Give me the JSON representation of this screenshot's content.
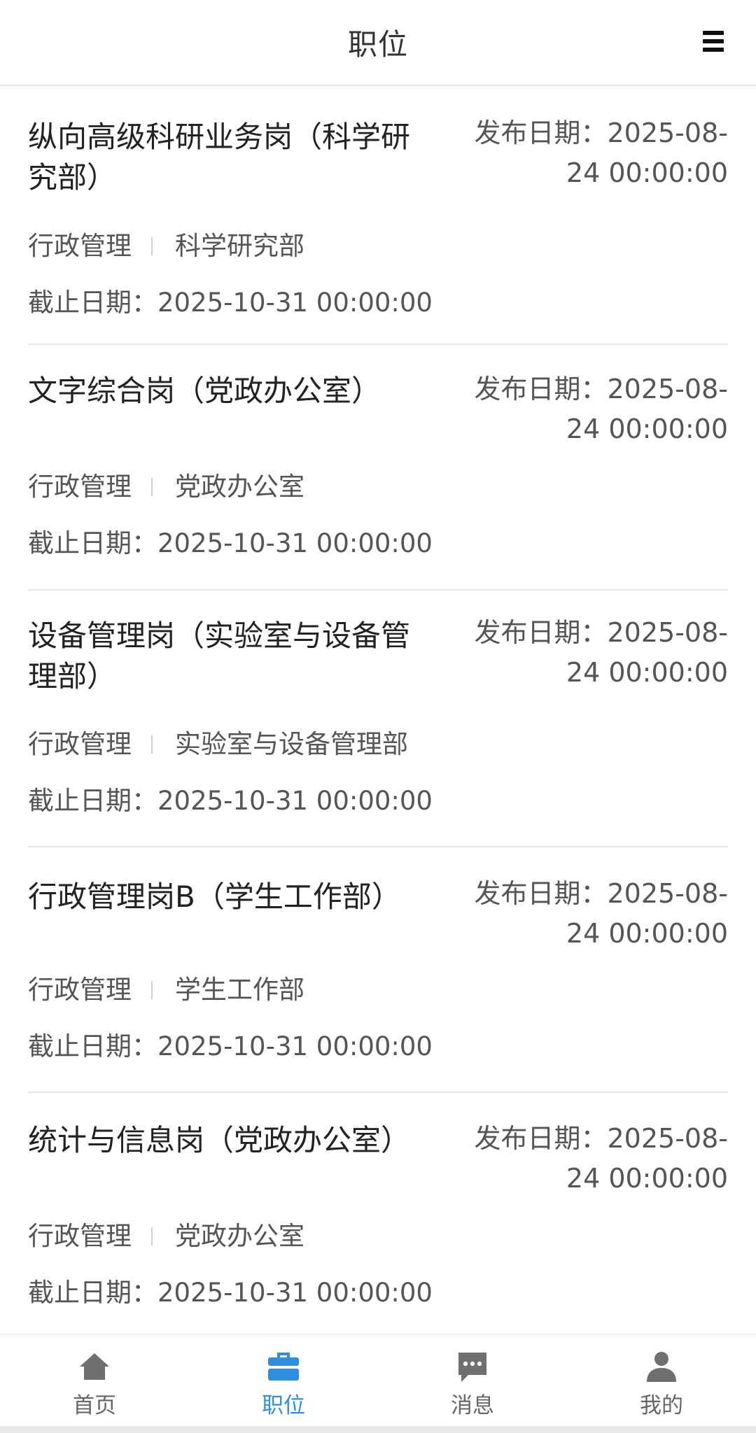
{
  "header": {
    "title": "职位"
  },
  "jobs": [
    {
      "title": "纵向高级科研业务岗（科学研究部）",
      "publish": "发布日期：2025-08-24 00:00:00",
      "category": "行政管理",
      "department": "科学研究部",
      "deadline": "截止日期：2025-10-31 00:00:00"
    },
    {
      "title": "文字综合岗（党政办公室）",
      "publish": "发布日期：2025-08-24 00:00:00",
      "category": "行政管理",
      "department": "党政办公室",
      "deadline": "截止日期：2025-10-31 00:00:00"
    },
    {
      "title": "设备管理岗（实验室与设备管理部）",
      "publish": "发布日期：2025-08-24 00:00:00",
      "category": "行政管理",
      "department": "实验室与设备管理部",
      "deadline": "截止日期：2025-10-31 00:00:00"
    },
    {
      "title": "行政管理岗B（学生工作部）",
      "publish": "发布日期：2025-08-24 00:00:00",
      "category": "行政管理",
      "department": "学生工作部",
      "deadline": "截止日期：2025-10-31 00:00:00"
    },
    {
      "title": "统计与信息岗（党政办公室）",
      "publish": "发布日期：2025-08-24 00:00:00",
      "category": "行政管理",
      "department": "党政办公室",
      "deadline": "截止日期：2025-10-31 00:00:00"
    }
  ],
  "tabbar": {
    "items": [
      {
        "label": "首页",
        "icon": "home-icon"
      },
      {
        "label": "职位",
        "icon": "briefcase-icon"
      },
      {
        "label": "消息",
        "icon": "chat-icon"
      },
      {
        "label": "我的",
        "icon": "user-icon"
      }
    ],
    "active_color": "#2f8ee0",
    "inactive_color": "#666666"
  }
}
